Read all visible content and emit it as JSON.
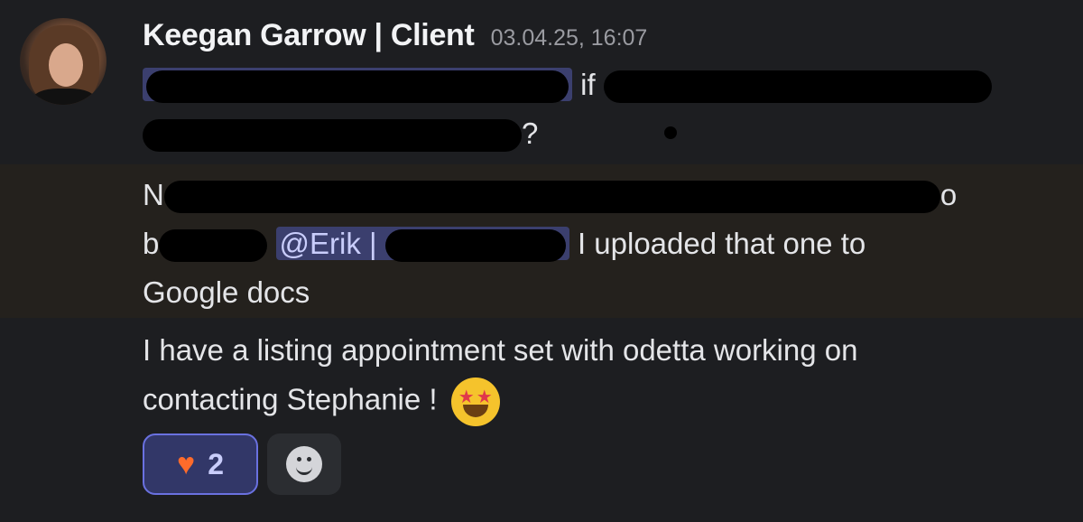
{
  "message": {
    "author": "Keegan Garrow | Client",
    "timestamp": "03.04.25, 16:07",
    "line1_suffix": "if",
    "line2_suffix": "?",
    "line3_prefix": "N",
    "line3_suffix": "o",
    "line4_prefix": "b",
    "mention_erik": "@Erik |",
    "line4_suffix": "I uploaded that one to",
    "line5": "Google docs",
    "line6": "I have a listing appointment set with odetta working on",
    "line7": "contacting Stephanie !",
    "emoji": "star-struck"
  },
  "reactions": [
    {
      "emoji": "fire-heart",
      "count": "2",
      "active": true
    },
    {
      "emoji": "add-reaction-icon"
    }
  ],
  "colors": {
    "background": "#1d1e21",
    "mention_bg": "#3b3f6e",
    "mention_text": "#c9cdfb",
    "reaction_active_border": "#6a71e0"
  }
}
